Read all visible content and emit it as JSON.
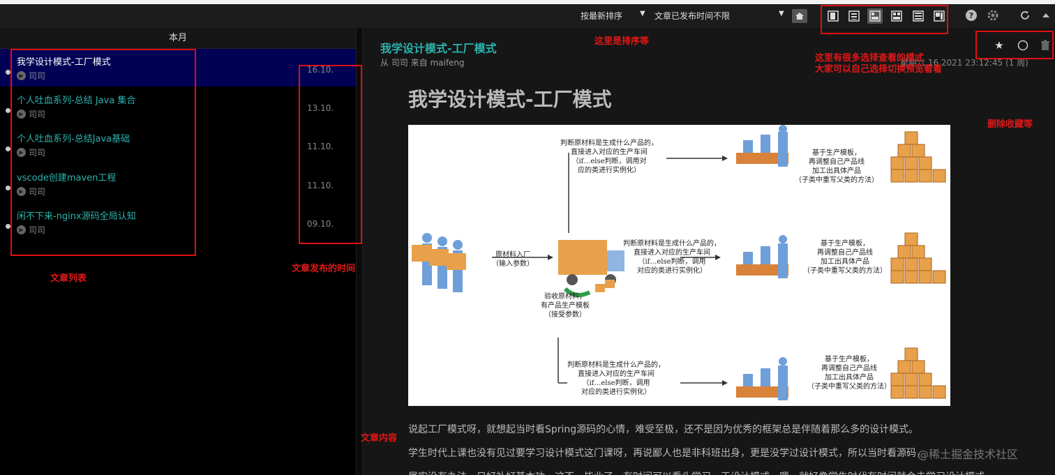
{
  "toolbar": {
    "sort_label": "按最新排序",
    "filter_label": "文章已发布时间不限"
  },
  "list": {
    "month_header": "本月",
    "items": [
      {
        "title": "我学设计模式-工厂模式",
        "author": "司司",
        "date": "16.10."
      },
      {
        "title": "个人吐血系列-总结 Java 集合",
        "author": "司司",
        "date": "13.10."
      },
      {
        "title": "个人吐血系列-总结Java基础",
        "author": "司司",
        "date": "11.10."
      },
      {
        "title": "vscode创建maven工程",
        "author": "司司",
        "date": "11.10."
      },
      {
        "title": "闲不下来-nginx源码全局认知",
        "author": "司司",
        "date": "09.10."
      }
    ]
  },
  "article": {
    "head_title": "我学设计模式-工厂模式",
    "meta": "从 司司 来自 maifeng",
    "time": "星期六 16 2021 23:12:45 (1 周)",
    "content_title": "我学设计模式-工厂模式",
    "paragraphs": [
      "说起工厂模式呀，就想起当时看Spring源码的心情，难受至极，还不是因为优秀的框架总是伴随着那么多的设计模式。",
      "学生时代上课也没有见过要学习设计模式这门课呀，再说鄙人也是非科班出身，更是没学过设计模式，所以当时看源码，",
      "属实没有办法，只好补好基本功。这不，毕业了，有时间可以看头学习，于设计模式。嗯，就好像学生时代有时间就会去学习设计模式。"
    ]
  },
  "diagram": {
    "raw_label": "原材料入厂\n（输入参数）",
    "check_label": "验收原材料，\n有产品生产模板\n（接受参数）",
    "judge_label": "判断原材料是生成什么产品的，\n直接进入对应的生产车间\n（if…else判断，调用对\n应的类进行实例化）",
    "judge_label_mid": "判断原材料是生成什么产品的，\n直接进入对应的生产车间\n（if…else判断，调用\n对应的类进行实例化）",
    "judge_label_bottom": "判断原材料是生成什么产品的，\n直接进入对应的生产车间\n（if…else判断，调用\n对应的类进行实例化）",
    "produce_label": "基于生产模板，\n再调整自己产品线\n加工出具体产品\n（子类中重写父类的方法）"
  },
  "annotations": {
    "sort": "这里是排序等",
    "view_modes": "这里有很多选择查看的模式\n大家可以自己选择切换预览看着",
    "actions": "删除收藏等",
    "list": "文章列表",
    "dates": "文章发布的时间",
    "content": "文章内容"
  },
  "watermark": "@稀土掘金技术社区",
  "colors": {
    "accent": "#2bb3ad",
    "annotation": "#e01010",
    "selected": "#000055"
  }
}
